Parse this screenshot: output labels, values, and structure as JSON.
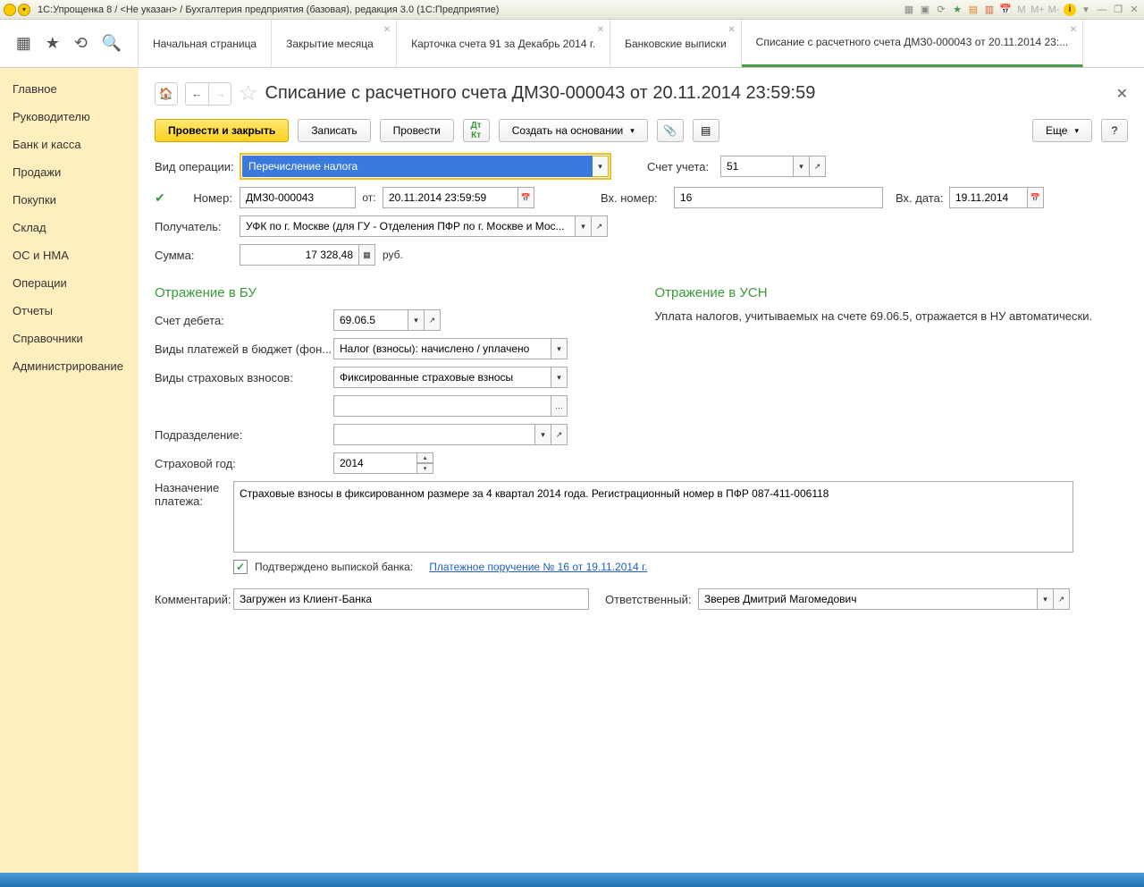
{
  "window": {
    "title": "1С:Упрощенка 8 / <Не указан> / Бухгалтерия предприятия (базовая), редакция 3.0  (1С:Предприятие)"
  },
  "tabs": [
    {
      "label": "Начальная страница",
      "closable": false
    },
    {
      "label": "Закрытие месяца",
      "closable": true
    },
    {
      "label": "Карточка счета 91 за Декабрь 2014 г.",
      "closable": true
    },
    {
      "label": "Банковские выписки",
      "closable": true
    },
    {
      "label": "Списание с расчетного счета ДМЗ0-000043 от 20.11.2014 23:...",
      "closable": true,
      "active": true
    }
  ],
  "sidebar": {
    "items": [
      "Главное",
      "Руководителю",
      "Банк и касса",
      "Продажи",
      "Покупки",
      "Склад",
      "ОС и НМА",
      "Операции",
      "Отчеты",
      "Справочники",
      "Администрирование"
    ]
  },
  "doc": {
    "title": "Списание с расчетного счета ДМЗ0-000043 от 20.11.2014 23:59:59"
  },
  "toolbar": {
    "post_close": "Провести и закрыть",
    "save": "Записать",
    "post": "Провести",
    "create_based": "Создать на основании",
    "more": "Еще"
  },
  "labels": {
    "operation_type": "Вид операции:",
    "account": "Счет учета:",
    "number": "Номер:",
    "from": "от:",
    "in_number": "Вх. номер:",
    "in_date": "Вх. дата:",
    "recipient": "Получатель:",
    "amount": "Сумма:",
    "currency": "руб.",
    "section_bu": "Отражение в БУ",
    "section_usn": "Отражение в УСН",
    "usn_note": "Уплата налогов, учитываемых на счете 69.06.5, отражается в НУ автоматически.",
    "debit_account": "Счет дебета:",
    "payment_types": "Виды платежей в бюджет (фон...",
    "insurance_types": "Виды страховых взносов:",
    "subdivision": "Подразделение:",
    "insurance_year": "Страховой год:",
    "purpose": "Назначение платежа:",
    "confirmed": "Подтверждено выпиской банка:",
    "payment_order_link": "Платежное поручение № 16 от 19.11.2014 г.",
    "comment": "Комментарий:",
    "responsible": "Ответственный:"
  },
  "values": {
    "operation_type": "Перечисление налога",
    "account": "51",
    "number": "ДМЗ0-000043",
    "date": "20.11.2014 23:59:59",
    "in_number": "16",
    "in_date": "19.11.2014",
    "recipient": "УФК по г. Москве (для ГУ - Отделения ПФР по г. Москве и Мос...",
    "amount": "17 328,48",
    "debit_account": "69.06.5",
    "payment_types": "Налог (взносы): начислено / уплачено",
    "insurance_types": "Фиксированные страховые взносы",
    "subdivision": "",
    "insurance_year": "2014",
    "purpose": "Страховые взносы в фиксированном размере за 4 квартал 2014 года. Регистрационный номер в ПФР 087-411-006118",
    "comment": "Загружен из Клиент-Банка",
    "responsible": "Зверев Дмитрий Магомедович"
  }
}
